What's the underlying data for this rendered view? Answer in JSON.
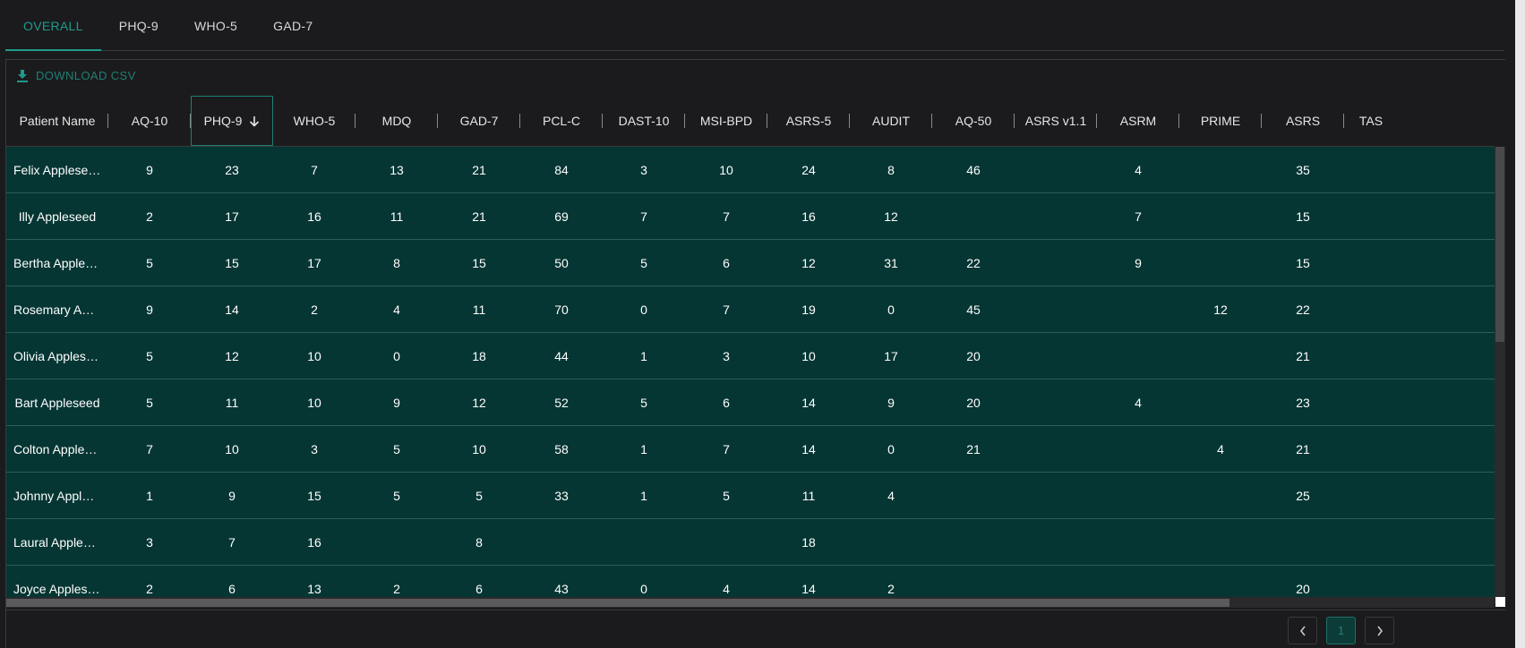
{
  "tabs": [
    "OVERALL",
    "PHQ-9",
    "WHO-5",
    "GAD-7"
  ],
  "active_tab": "OVERALL",
  "toolbar": {
    "download_label": "DOWNLOAD CSV"
  },
  "table": {
    "columns": [
      "Patient Name",
      "AQ-10",
      "PHQ-9",
      "WHO-5",
      "MDQ",
      "GAD-7",
      "PCL-C",
      "DAST-10",
      "MSI-BPD",
      "ASRS-5",
      "AUDIT",
      "AQ-50",
      "ASRS v1.1",
      "ASRM",
      "PRIME",
      "ASRS",
      "TAS"
    ],
    "sorted_column": "PHQ-9",
    "sort_direction": "descending",
    "rows": [
      [
        "Felix Appleseed",
        "9",
        "23",
        "7",
        "13",
        "21",
        "84",
        "3",
        "10",
        "24",
        "8",
        "46",
        "",
        "4",
        "",
        "35",
        ""
      ],
      [
        "Illy Appleseed",
        "2",
        "17",
        "16",
        "11",
        "21",
        "69",
        "7",
        "7",
        "16",
        "12",
        "",
        "",
        "7",
        "",
        "15",
        ""
      ],
      [
        "Bertha Appleseed",
        "5",
        "15",
        "17",
        "8",
        "15",
        "50",
        "5",
        "6",
        "12",
        "31",
        "22",
        "",
        "9",
        "",
        "15",
        ""
      ],
      [
        "Rosemary Appleseed",
        "9",
        "14",
        "2",
        "4",
        "11",
        "70",
        "0",
        "7",
        "19",
        "0",
        "45",
        "",
        "",
        "12",
        "22",
        ""
      ],
      [
        "Olivia Appleseed",
        "5",
        "12",
        "10",
        "0",
        "18",
        "44",
        "1",
        "3",
        "10",
        "17",
        "20",
        "",
        "",
        "",
        "21",
        ""
      ],
      [
        "Bart Appleseed",
        "5",
        "11",
        "10",
        "9",
        "12",
        "52",
        "5",
        "6",
        "14",
        "9",
        "20",
        "",
        "4",
        "",
        "23",
        ""
      ],
      [
        "Colton Appleseed",
        "7",
        "10",
        "3",
        "5",
        "10",
        "58",
        "1",
        "7",
        "14",
        "0",
        "21",
        "",
        "",
        "4",
        "21",
        ""
      ],
      [
        "Johnny Appleseed",
        "1",
        "9",
        "15",
        "5",
        "5",
        "33",
        "1",
        "5",
        "11",
        "4",
        "",
        "",
        "",
        "",
        "25",
        ""
      ],
      [
        "Laural Appleseed",
        "3",
        "7",
        "16",
        "",
        "8",
        "",
        "",
        "",
        "18",
        "",
        "",
        "",
        "",
        "",
        "",
        ""
      ],
      [
        "Joyce Appleseed",
        "2",
        "6",
        "13",
        "2",
        "6",
        "43",
        "0",
        "4",
        "14",
        "2",
        "",
        "",
        "",
        "",
        "20",
        ""
      ]
    ]
  },
  "pagination": {
    "current_page": "1"
  },
  "colors": {
    "accent": "#1f9b8c",
    "row_bg": "#053633",
    "background": "#1b1b1d"
  },
  "icons": {
    "download": "download-icon",
    "sort": "arrow-down-icon",
    "prev": "chevron-left-icon",
    "next": "chevron-right-icon"
  }
}
